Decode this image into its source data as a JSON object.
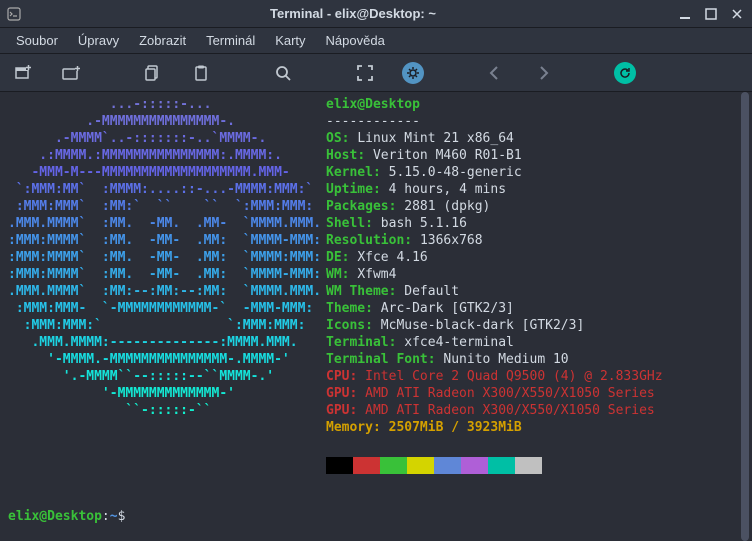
{
  "titlebar": {
    "title": "Terminal - elix@Desktop: ~"
  },
  "menu": {
    "file": "Soubor",
    "edit": "Úpravy",
    "view": "Zobrazit",
    "terminal": "Terminál",
    "tabs": "Karty",
    "help": "Nápověda"
  },
  "neofetch": {
    "header": "elix@Desktop",
    "sep": "------------",
    "os_label": "OS",
    "os": "Linux Mint 21 x86_64",
    "host_label": "Host",
    "host": "Veriton M460 R01-B1",
    "kernel_label": "Kernel",
    "kernel": "5.15.0-48-generic",
    "uptime_label": "Uptime",
    "uptime": "4 hours, 4 mins",
    "packages_label": "Packages",
    "packages": "2881 (dpkg)",
    "shell_label": "Shell",
    "shell": "bash 5.1.16",
    "resolution_label": "Resolution",
    "resolution": "1366x768",
    "de_label": "DE",
    "de": "Xfce 4.16",
    "wm_label": "WM",
    "wm": "Xfwm4",
    "wmtheme_label": "WM Theme",
    "wmtheme": "Default",
    "theme_label": "Theme",
    "theme": "Arc-Dark [GTK2/3]",
    "icons_label": "Icons",
    "icons": "McMuse-black-dark [GTK2/3]",
    "terminal_label": "Terminal",
    "terminal": "xfce4-terminal",
    "font_label": "Terminal Font",
    "font": "Nunito Medium 10",
    "cpu_label": "CPU",
    "cpu": "Intel Core 2 Quad Q9500 (4) @ 2.833GHz",
    "gpu1_label": "GPU",
    "gpu1": "AMD ATI Radeon X300/X550/X1050 Series",
    "gpu2_label": "GPU",
    "gpu2": "AMD ATI Radeon X300/X550/X1050 Series",
    "memory_label": "Memory",
    "memory": "2507MiB / 3923MiB"
  },
  "palette": [
    "#000000",
    "#cc3333",
    "#39c139",
    "#d4d400",
    "#5f87d7",
    "#af5fd7",
    "#00bfa5",
    "#c0c0c0"
  ],
  "prompt": {
    "user": "elix@Desktop",
    "colon": ":",
    "path": "~",
    "symbol": "$ "
  },
  "ascii": [
    {
      "c": "#7272d8",
      "t": "             ...-:::::-..."
    },
    {
      "c": "#6f6fdc",
      "t": "          .-MMMMMMMMMMMMMMM-."
    },
    {
      "c": "#6b6be0",
      "t": "      .-MMMM`..-:::::::-..`MMMM-."
    },
    {
      "c": "#6868e3",
      "t": "    .:MMMM.:MMMMMMMMMMMMMMM:.MMMM:."
    },
    {
      "c": "#6464e7",
      "t": "   -MMM-M---MMMMMMMMMMMMMMMMMMM.MMM-"
    },
    {
      "c": "#5c70e8",
      "t": " `:MMM:MM`  :MMMM:....::-...-MMMM:MMM:`"
    },
    {
      "c": "#547ce8",
      "t": " :MMM:MMM`  :MM:`  ``    ``  `:MMM:MMM:"
    },
    {
      "c": "#4c88e9",
      "t": ".MMM.MMMM`  :MM.  -MM.  .MM-  `MMMM.MMM."
    },
    {
      "c": "#4494ea",
      "t": ":MMM:MMMM`  :MM.  -MM-  .MM:  `MMMM-MMM:"
    },
    {
      "c": "#3da0ea",
      "t": ":MMM:MMMM`  :MM.  -MM-  .MM:  `MMMM:MMM:"
    },
    {
      "c": "#35acea",
      "t": ":MMM:MMMM`  :MM.  -MM-  .MM:  `MMMM-MMM:"
    },
    {
      "c": "#2eb7e9",
      "t": ".MMM.MMMM`  :MM:--:MM:--:MM:  `MMMM.MMM."
    },
    {
      "c": "#27c1e8",
      "t": " :MMM:MMM-  `-MMMMMMMMMMMM-`  -MMM-MMM:"
    },
    {
      "c": "#21cbe6",
      "t": "  :MMM:MMM:`                `:MMM:MMM:"
    },
    {
      "c": "#1cd4e3",
      "t": "   .MMM.MMMM:--------------:MMMM.MMM."
    },
    {
      "c": "#18dcdf",
      "t": "     '-MMMM.-MMMMMMMMMMMMMMM-.MMMM-'"
    },
    {
      "c": "#15e3da",
      "t": "       '.-MMMM``--:::::--``MMMM-.'"
    },
    {
      "c": "#13e9d4",
      "t": "            '-MMMMMMMMMMMMM-'"
    },
    {
      "c": "#12eecd",
      "t": "               ``-:::::-``"
    }
  ]
}
